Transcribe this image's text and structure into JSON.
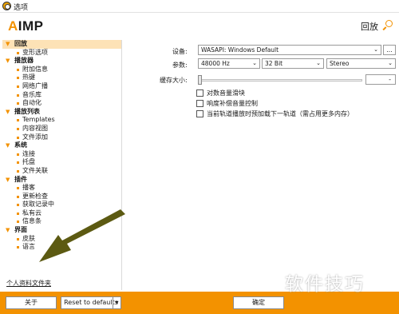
{
  "window": {
    "title": "选项"
  },
  "header": {
    "logo_mark": "A",
    "logo_text": "IMP",
    "back_label": "回放"
  },
  "sidebar": {
    "groups": [
      {
        "label": "回放",
        "items": [
          "变形选项"
        ]
      },
      {
        "label": "播放器",
        "items": [
          "附加信息",
          "热键",
          "网络广播",
          "音乐库",
          "自动化"
        ]
      },
      {
        "label": "播放列表",
        "items": [
          "Templates",
          "内容视图",
          "文件添加"
        ]
      },
      {
        "label": "系统",
        "items": [
          "连接",
          "托盘",
          "文件关联"
        ]
      },
      {
        "label": "插件",
        "items": [
          "播客",
          "更新检查",
          "获取记录中",
          "私有云",
          "信息条"
        ]
      },
      {
        "label": "界面",
        "items": [
          "皮肤",
          "语言"
        ]
      }
    ],
    "profile_link": "个人资料文件夹"
  },
  "main": {
    "device_label": "设备:",
    "device_value": "WASAPI: Windows Default",
    "device_more": "...",
    "params_label": "参数:",
    "samplerate": "48000 Hz",
    "bitdepth": "32 Bit",
    "channels": "Stereo",
    "buffer_label": "缓存大小:",
    "buffer_value": "-",
    "buffer_level": 0,
    "checkboxes": [
      "对数音量滑块",
      "响度补偿音量控制",
      "当前轨道播放时预加载下一轨道（需占用更多内存）"
    ]
  },
  "footer": {
    "about": "关于",
    "reset": "Reset to defaults",
    "ok": "确定"
  },
  "watermark": "软件技巧",
  "colors": {
    "accent": "#f39200",
    "selection": "#fde2b6",
    "arrow": "#5c5a12"
  }
}
